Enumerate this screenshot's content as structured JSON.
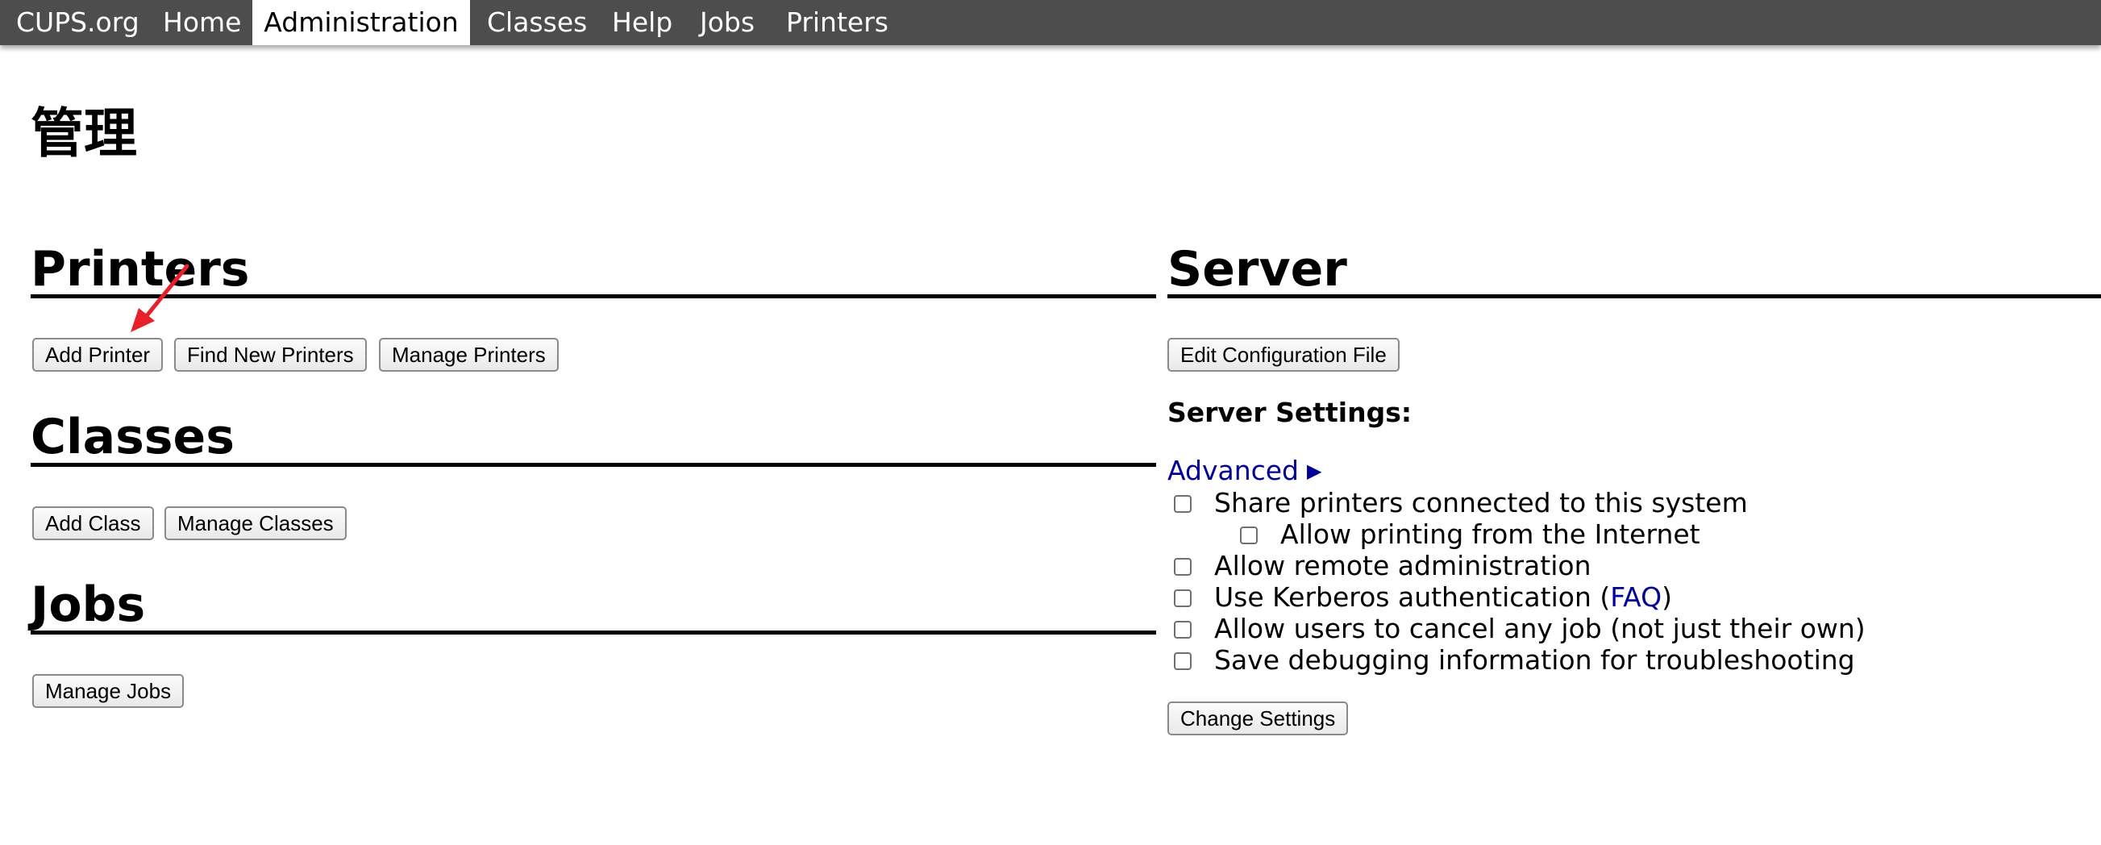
{
  "nav": {
    "site": "CUPS.org",
    "home": "Home",
    "administration": "Administration",
    "classes": "Classes",
    "help": "Help",
    "jobs": "Jobs",
    "printers": "Printers"
  },
  "page_title": "管理",
  "sections": {
    "printers": {
      "title": "Printers",
      "add_printer": "Add Printer",
      "find_new_printers": "Find New Printers",
      "manage_printers": "Manage Printers"
    },
    "classes": {
      "title": "Classes",
      "add_class": "Add Class",
      "manage_classes": "Manage Classes"
    },
    "jobs": {
      "title": "Jobs",
      "manage_jobs": "Manage Jobs"
    },
    "server": {
      "title": "Server",
      "edit_config": "Edit Configuration File",
      "settings_label": "Server Settings:",
      "advanced": "Advanced",
      "options": {
        "share_printers": "Share printers connected to this system",
        "allow_internet": "Allow printing from the Internet",
        "remote_admin": "Allow remote administration",
        "kerberos_prefix": "Use Kerberos authentication (",
        "kerberos_faq": "FAQ",
        "kerberos_suffix": ")",
        "cancel_any_job": "Allow users to cancel any job (not just their own)",
        "debug_logging": "Save debugging information for troubleshooting"
      },
      "change_settings": "Change Settings"
    }
  },
  "colors": {
    "nav_bg": "#4d4d4d",
    "link": "#000099",
    "annotation_arrow": "#e8202a"
  },
  "icons": {
    "advanced_toggle": "triangle-right-icon",
    "annotation": "red-arrow-icon"
  }
}
